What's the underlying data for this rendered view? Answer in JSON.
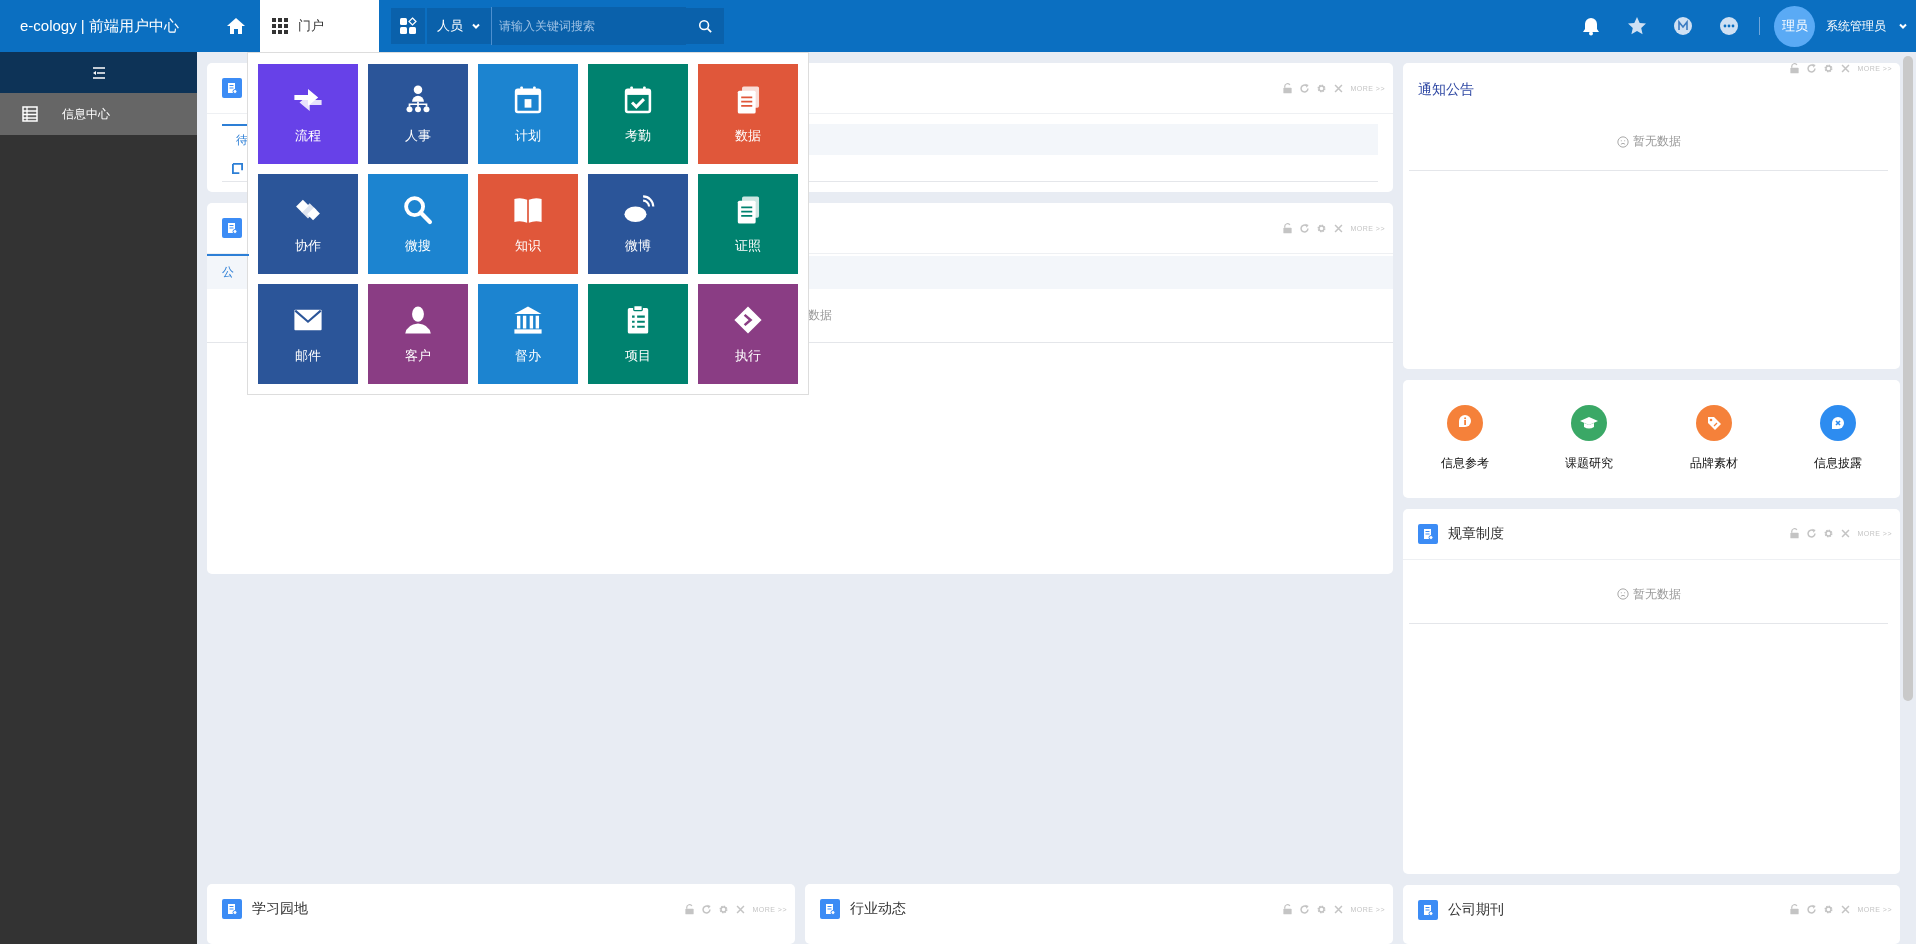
{
  "header": {
    "logo": "e-cology | 前端用户中心",
    "portal_tab": {
      "label": "门户",
      "selected": true
    },
    "search": {
      "scope": "人员",
      "placeholder": "请输入关键词搜索"
    },
    "user": {
      "avatar": "理员",
      "name": "系统管理员"
    }
  },
  "sidebar": {
    "items": [
      {
        "label": "信息中心",
        "selected": true
      }
    ]
  },
  "portal_menu": {
    "tiles": [
      {
        "label": "流程",
        "color": "#6741e8"
      },
      {
        "label": "人事",
        "color": "#2b5599"
      },
      {
        "label": "计划",
        "color": "#1c84d0"
      },
      {
        "label": "考勤",
        "color": "#00826f"
      },
      {
        "label": "数据",
        "color": "#e0573a"
      },
      {
        "label": "协作",
        "color": "#2b5599"
      },
      {
        "label": "微搜",
        "color": "#1c84d0"
      },
      {
        "label": "知识",
        "color": "#e0573a"
      },
      {
        "label": "微博",
        "color": "#2b5599"
      },
      {
        "label": "证照",
        "color": "#00826f"
      },
      {
        "label": "邮件",
        "color": "#2b5599"
      },
      {
        "label": "客户",
        "color": "#8a3d84"
      },
      {
        "label": "督办",
        "color": "#1c84d0"
      },
      {
        "label": "项目",
        "color": "#00826f"
      },
      {
        "label": "执行",
        "color": "#8a3d84"
      }
    ]
  },
  "left_panels": [
    {
      "tab": {
        "label": "待",
        "selected": true
      },
      "more": "MORE >>"
    },
    {
      "tab": {
        "label": "公",
        "selected": true
      },
      "empty_text": "数据",
      "more": "MORE >>"
    }
  ],
  "notice_panel": {
    "title": "通知公告",
    "empty_text": "暂无数据",
    "more": "MORE >>"
  },
  "quick_links": [
    {
      "label": "信息参考",
      "color": "#f5813a"
    },
    {
      "label": "课题研究",
      "color": "#3aa866"
    },
    {
      "label": "品牌素材",
      "color": "#f5813a"
    },
    {
      "label": "信息披露",
      "color": "#2d8cf0"
    }
  ],
  "rules_panel": {
    "title": "规章制度",
    "empty_text": "暂无数据",
    "more": "MORE >>"
  },
  "bottom_panels": [
    {
      "title": "学习园地",
      "more": "MORE >>"
    },
    {
      "title": "行业动态",
      "more": "MORE >>"
    },
    {
      "title": "公司期刊",
      "more": "MORE >>"
    }
  ]
}
